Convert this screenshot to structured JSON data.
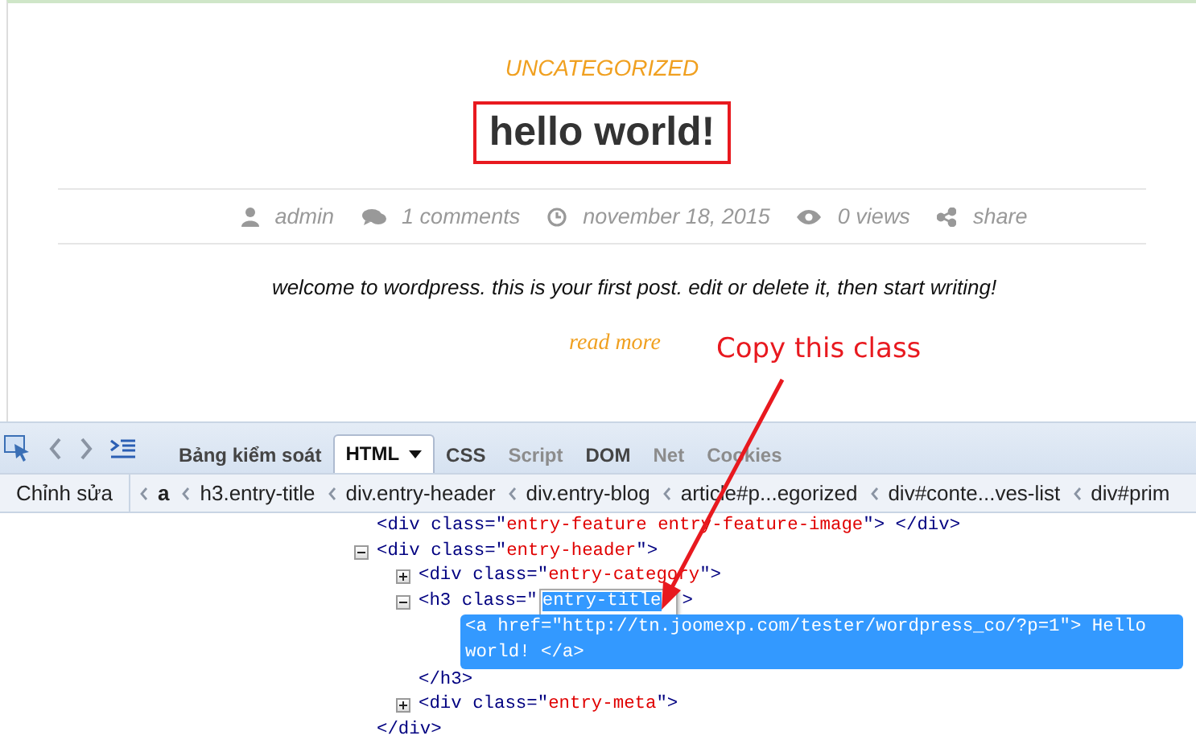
{
  "post": {
    "category": "UNCATEGORIZED",
    "title": "hello world!",
    "meta": [
      {
        "kind": "author",
        "text": "admin"
      },
      {
        "kind": "comments",
        "text": "1 comments"
      },
      {
        "kind": "date",
        "text": "november 18, 2015"
      },
      {
        "kind": "views",
        "text": "0 views"
      },
      {
        "kind": "share",
        "text": "share"
      }
    ],
    "excerpt": "welcome to wordpress. this is your first post. edit or delete it, then start writing!",
    "read_more": "read more"
  },
  "annotation": {
    "label": "Copy this class"
  },
  "devtools": {
    "tabs": [
      {
        "label": "Bảng kiểm soát",
        "selected": false,
        "disabled": false,
        "has_menu": false
      },
      {
        "label": "HTML",
        "selected": true,
        "disabled": false,
        "has_menu": true
      },
      {
        "label": "CSS",
        "selected": false,
        "disabled": false,
        "has_menu": false
      },
      {
        "label": "Script",
        "selected": false,
        "disabled": true,
        "has_menu": false
      },
      {
        "label": "DOM",
        "selected": false,
        "disabled": false,
        "has_menu": false
      },
      {
        "label": "Net",
        "selected": false,
        "disabled": true,
        "has_menu": false
      },
      {
        "label": "Cookies",
        "selected": false,
        "disabled": true,
        "has_menu": false
      }
    ],
    "edit_button": "Chỉnh sửa",
    "breadcrumbs": [
      {
        "label": "a",
        "selected": true
      },
      {
        "label": "h3.entry-title",
        "selected": false
      },
      {
        "label": "div.entry-header",
        "selected": false
      },
      {
        "label": "div.entry-blog",
        "selected": false
      },
      {
        "label": "article#p...egorized",
        "selected": false
      },
      {
        "label": "div#conte...ves-list",
        "selected": false
      },
      {
        "label": "div#prim",
        "selected": false
      }
    ],
    "tree": [
      {
        "kind": "leaf",
        "selected": false,
        "parts": [
          {
            "kind": "tag",
            "text": "<div class=\""
          },
          {
            "kind": "value",
            "text": "entry-feature entry-feature-image"
          },
          {
            "kind": "tag",
            "text": "\"> </div>"
          }
        ]
      },
      {
        "kind": "node",
        "expanded": true,
        "selected": false,
        "parts": [
          {
            "kind": "tag",
            "text": "<div class=\""
          },
          {
            "kind": "value",
            "text": "entry-header"
          },
          {
            "kind": "tag",
            "text": "\">"
          }
        ],
        "children": [
          {
            "kind": "node",
            "expanded": false,
            "selected": false,
            "parts": [
              {
                "kind": "tag",
                "text": "<div class=\""
              },
              {
                "kind": "value",
                "text": "entry-category"
              },
              {
                "kind": "tag",
                "text": "\">"
              }
            ]
          },
          {
            "kind": "node",
            "expanded": true,
            "selected": false,
            "parts": [
              {
                "kind": "tag",
                "text": "<h3 class=\""
              },
              {
                "kind": "edit",
                "text": "entry-title"
              },
              {
                "kind": "tag",
                "text": ">"
              }
            ],
            "children": [
              {
                "kind": "leaf",
                "selected": true,
                "parts": [
                  {
                    "kind": "tag",
                    "text": "<a href=\"http://tn.joomexp.com/tester/wordpress_co/?p=1\"> Hello world! </a>"
                  }
                ]
              }
            ]
          },
          {
            "kind": "leaf",
            "selected": false,
            "parts": [
              {
                "kind": "tag",
                "text": "</h3>"
              }
            ]
          },
          {
            "kind": "node",
            "expanded": false,
            "selected": false,
            "parts": [
              {
                "kind": "tag",
                "text": "<div class=\""
              },
              {
                "kind": "value",
                "text": "entry-meta"
              },
              {
                "kind": "tag",
                "text": "\">"
              }
            ]
          }
        ]
      },
      {
        "kind": "leaf",
        "selected": false,
        "parts": [
          {
            "kind": "tag",
            "text": "</div>"
          }
        ]
      }
    ]
  }
}
